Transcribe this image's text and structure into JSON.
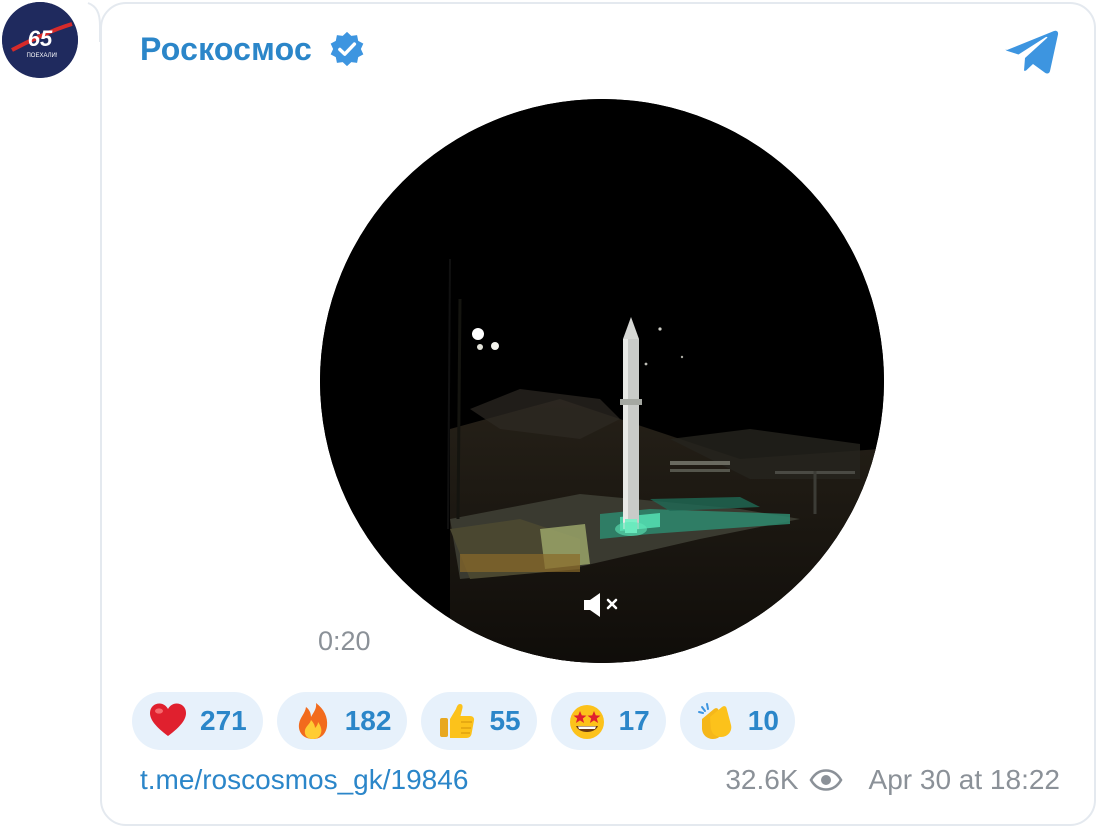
{
  "avatar": {
    "number": "65",
    "caption": "ПОЕХАЛИ!"
  },
  "channel": {
    "name": "Роскосмос",
    "verified": true,
    "accent_color": "#2b86c9"
  },
  "video": {
    "duration": "0:20",
    "muted": true,
    "mute_icon": "speaker-muted-icon"
  },
  "reactions": [
    {
      "emoji": "red-heart",
      "count": "271"
    },
    {
      "emoji": "fire",
      "count": "182"
    },
    {
      "emoji": "thumbs-up",
      "count": "55"
    },
    {
      "emoji": "star-struck",
      "count": "17"
    },
    {
      "emoji": "clapping-hands",
      "count": "10"
    }
  ],
  "footer": {
    "link": "t.me/roscosmos_gk/19846",
    "views": "32.6K",
    "date": "Apr 30 at 18:22"
  },
  "icons": {
    "brand": "telegram-icon",
    "views": "eye-icon",
    "verified": "verified-badge-icon"
  }
}
